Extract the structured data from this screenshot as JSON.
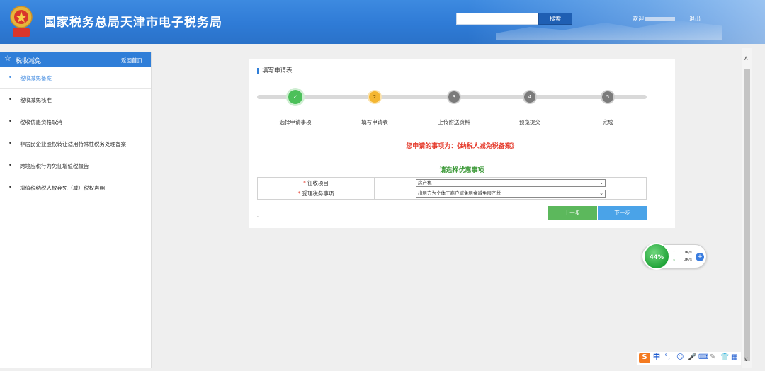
{
  "header": {
    "site_title": "国家税务总局天津市电子税务局",
    "search_button": "搜索",
    "search_placeholder": "",
    "welcome_label": "欢迎",
    "logout_label": "退出",
    "emblem_text": "中国税务"
  },
  "sidebar": {
    "title": "税收减免",
    "back_label": "返回首页",
    "items": [
      {
        "label": "税收减免备案",
        "active": true
      },
      {
        "label": "税收减免核准",
        "active": false
      },
      {
        "label": "税收优惠资格取消",
        "active": false
      },
      {
        "label": "非居民企业股权转让适用特殊性税务处理备案",
        "active": false
      },
      {
        "label": "跨境应税行为免征增值税报告",
        "active": false
      },
      {
        "label": "增值税纳税人放弃免（减）税权声明",
        "active": false
      }
    ]
  },
  "main": {
    "panel_title": "填写申请表",
    "steps": [
      {
        "number": "✓",
        "label": "选择申请事项",
        "status": "done"
      },
      {
        "number": "2",
        "label": "填写申请表",
        "status": "current"
      },
      {
        "number": "3",
        "label": "上传附送资料",
        "status": "todo"
      },
      {
        "number": "4",
        "label": "预览提交",
        "status": "todo"
      },
      {
        "number": "5",
        "label": "完成",
        "status": "todo"
      }
    ],
    "notice": "您申请的事项为：《纳税人减免税备案》",
    "choose_title": "请选择优惠事项",
    "form": {
      "rows": [
        {
          "required_mark": "*",
          "label": "征收项目",
          "value": "房产税"
        },
        {
          "required_mark": "*",
          "label": "受理税务事项",
          "value": "出租方为个体工商户减免租金减免房产税"
        }
      ]
    },
    "dot_mark": ".",
    "prev_button": "上一步",
    "next_button": "下一步"
  },
  "speed_widget": {
    "percent": "44%",
    "up_arrow": "↑",
    "down_arrow": "↓",
    "upload": "0K/s",
    "download": "0K/s",
    "plus": "+"
  },
  "ime_toolbar": {
    "logo": "S",
    "lang": "中",
    "punct": "°,",
    "emoji": "☺",
    "mic": "🎤",
    "keyboard": "⌨",
    "skin": "✎",
    "shirt": "👕",
    "grid": "▦"
  },
  "scrollbar": {
    "up": "∧",
    "down": "∨"
  },
  "colors": {
    "header_blue": "#2f7bd6",
    "sidebar_head": "#2f7ed8",
    "notice_red": "#e53b2c",
    "choose_green": "#3e9a3a",
    "prev_green": "#5cb85c",
    "next_blue": "#4aa3e8",
    "step_done": "#4cc05a",
    "step_current": "#f4b632",
    "step_todo": "#7b7b7b"
  }
}
